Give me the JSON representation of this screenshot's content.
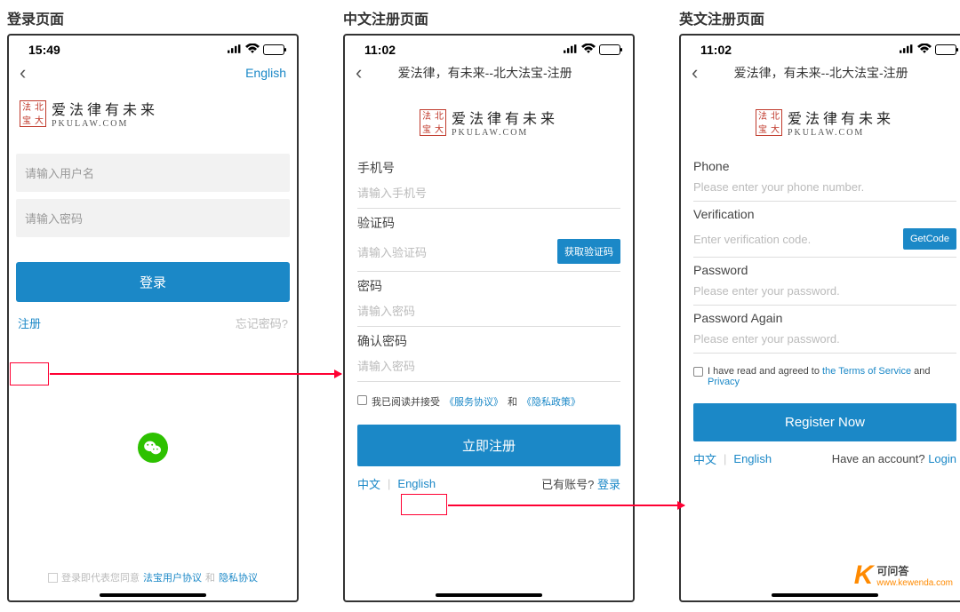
{
  "sections": {
    "login_title": "登录页面",
    "register_cn_title": "中文注册页面",
    "register_en_title": "英文注册页面"
  },
  "status": {
    "time_login": "15:49",
    "time_register": "11:02"
  },
  "logo": {
    "seal": [
      "法",
      "北",
      "宝",
      "大"
    ],
    "cn": "爱法律有未来",
    "en": "PKULAW.COM"
  },
  "login": {
    "english": "English",
    "username_ph": "请输入用户名",
    "password_ph": "请输入密码",
    "login_btn": "登录",
    "register_link": "注册",
    "forgot_link": "忘记密码?",
    "agree_prefix": "登录即代表您同意",
    "agree_terms": "法宝用户协议",
    "agree_and": "和",
    "agree_privacy": "隐私协议"
  },
  "register_cn": {
    "nav_title": "爱法律，有未来--北大法宝-注册",
    "phone_label": "手机号",
    "phone_ph": "请输入手机号",
    "code_label": "验证码",
    "code_ph": "请输入验证码",
    "code_btn": "获取验证码",
    "pwd_label": "密码",
    "pwd_ph": "请输入密码",
    "pwd2_label": "确认密码",
    "pwd2_ph": "请输入密码",
    "agree_prefix": "我已阅读并接受",
    "agree_terms": "《服务协议》",
    "agree_and": "和",
    "agree_privacy": "《隐私政策》",
    "submit": "立即注册",
    "lang_cn": "中文",
    "lang_en": "English",
    "have_account": "已有账号?",
    "login_link": "登录"
  },
  "register_en": {
    "nav_title": "爱法律，有未来--北大法宝-注册",
    "phone_label": "Phone",
    "phone_ph": "Please enter your phone number.",
    "code_label": "Verification",
    "code_ph": "Enter verification code.",
    "code_btn": "GetCode",
    "pwd_label": "Password",
    "pwd_ph": "Please enter your password.",
    "pwd2_label": "Password Again",
    "pwd2_ph": "Please enter your password.",
    "agree_prefix": "I have read and agreed to",
    "agree_terms": "the Terms of Service",
    "agree_and": "and",
    "agree_privacy": "Privacy",
    "submit": "Register Now",
    "lang_cn": "中文",
    "lang_en": "English",
    "have_account": "Have an account?",
    "login_link": "Login"
  },
  "watermark": {
    "name": "可问答",
    "url": "www.kewenda.com"
  }
}
